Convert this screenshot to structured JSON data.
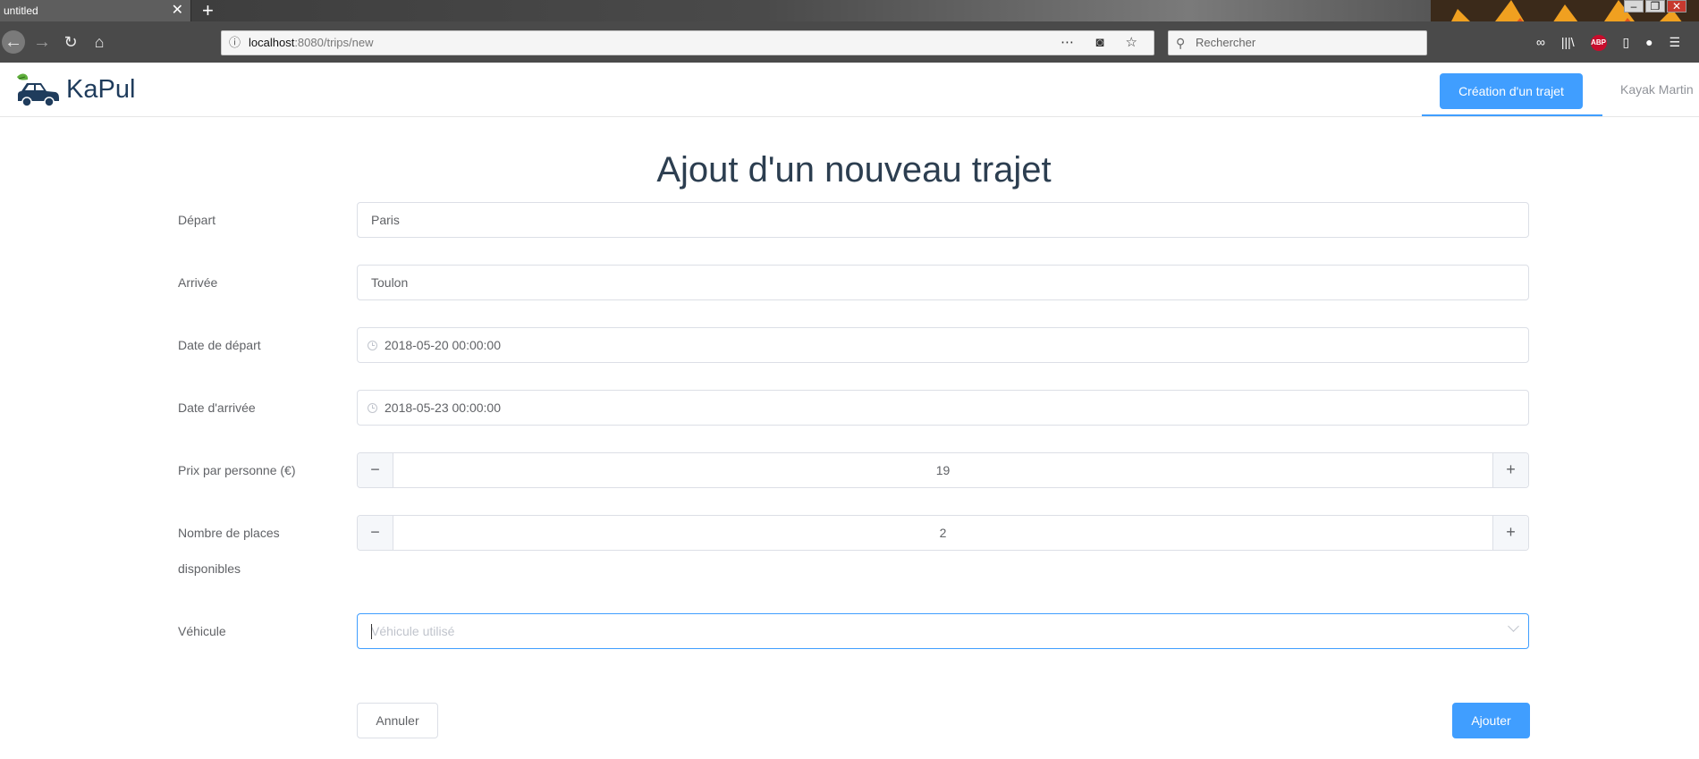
{
  "browser": {
    "tab_title": "untitled",
    "url_host": "localhost",
    "url_path": ":8080/trips/new",
    "search_placeholder": "Rechercher"
  },
  "app": {
    "logo_text": "KaPul",
    "nav_create": "Création d'un trajet",
    "user_name": "Kayak Martin"
  },
  "form": {
    "title": "Ajout d'un nouveau trajet",
    "depart": {
      "label": "Départ",
      "value": "Paris"
    },
    "arrivee": {
      "label": "Arrivée",
      "value": "Toulon"
    },
    "date_depart": {
      "label": "Date de départ",
      "value": "2018-05-20 00:00:00"
    },
    "date_arrivee": {
      "label": "Date d'arrivée",
      "value": "2018-05-23 00:00:00"
    },
    "prix": {
      "label": "Prix par personne (€)",
      "value": "19"
    },
    "places": {
      "label_line1": "Nombre de places",
      "label_line2": "disponibles",
      "value": "2"
    },
    "vehicule": {
      "label": "Véhicule",
      "placeholder": "Véhicule utilisé"
    },
    "cancel_label": "Annuler",
    "submit_label": "Ajouter"
  },
  "colors": {
    "accent": "#409eff",
    "title": "#2c3e50",
    "label": "#606266"
  }
}
